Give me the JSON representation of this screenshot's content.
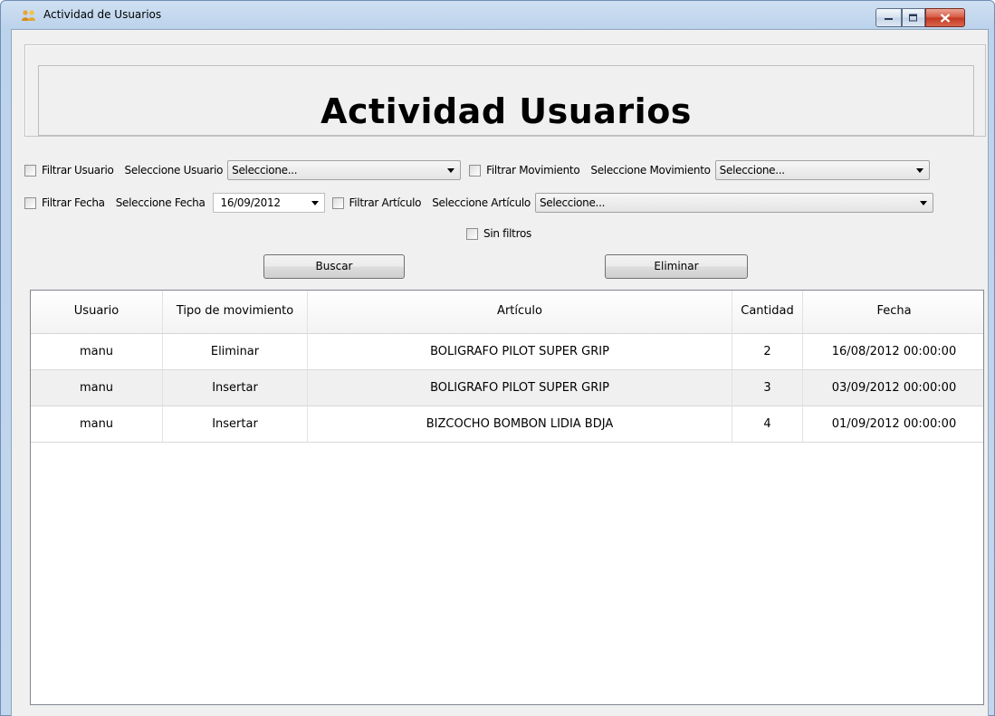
{
  "window": {
    "title": "Actividad de Usuarios",
    "app_icon": "users-icon"
  },
  "header": {
    "title": "Actividad Usuarios"
  },
  "filters": {
    "filtrar_usuario": {
      "label": "Filtrar Usuario",
      "checked": false
    },
    "usuario_label": "Seleccione Usuario",
    "usuario_value": "Seleccione...",
    "filtrar_movimiento": {
      "label": "Filtrar Movimiento",
      "checked": false
    },
    "movimiento_label": "Seleccione Movimiento",
    "movimiento_value": "Seleccione...",
    "filtrar_fecha": {
      "label": "Filtrar Fecha",
      "checked": false
    },
    "fecha_label": "Seleccione Fecha",
    "fecha_value": "16/09/2012",
    "filtrar_articulo": {
      "label": "Filtrar Artículo",
      "checked": false
    },
    "articulo_label": "Seleccione Artículo",
    "articulo_value": "Seleccione...",
    "sin_filtros": {
      "label": "Sin filtros",
      "checked": false
    }
  },
  "actions": {
    "buscar": "Buscar",
    "eliminar": "Eliminar"
  },
  "table": {
    "columns": [
      "Usuario",
      "Tipo de movimiento",
      "Artículo",
      "Cantidad",
      "Fecha"
    ],
    "rows": [
      [
        "manu",
        "Eliminar",
        "BOLIGRAFO PILOT SUPER GRIP",
        "2",
        "16/08/2012 00:00:00"
      ],
      [
        "manu",
        "Insertar",
        "BOLIGRAFO PILOT SUPER GRIP",
        "3",
        "03/09/2012 00:00:00"
      ],
      [
        "manu",
        "Insertar",
        "BIZCOCHO BOMBON LIDIA BDJA",
        "4",
        "01/09/2012 00:00:00"
      ]
    ]
  },
  "colors": {
    "frame": "#bcd3ec",
    "client": "#f0f0f0",
    "close": "#c1371f"
  }
}
